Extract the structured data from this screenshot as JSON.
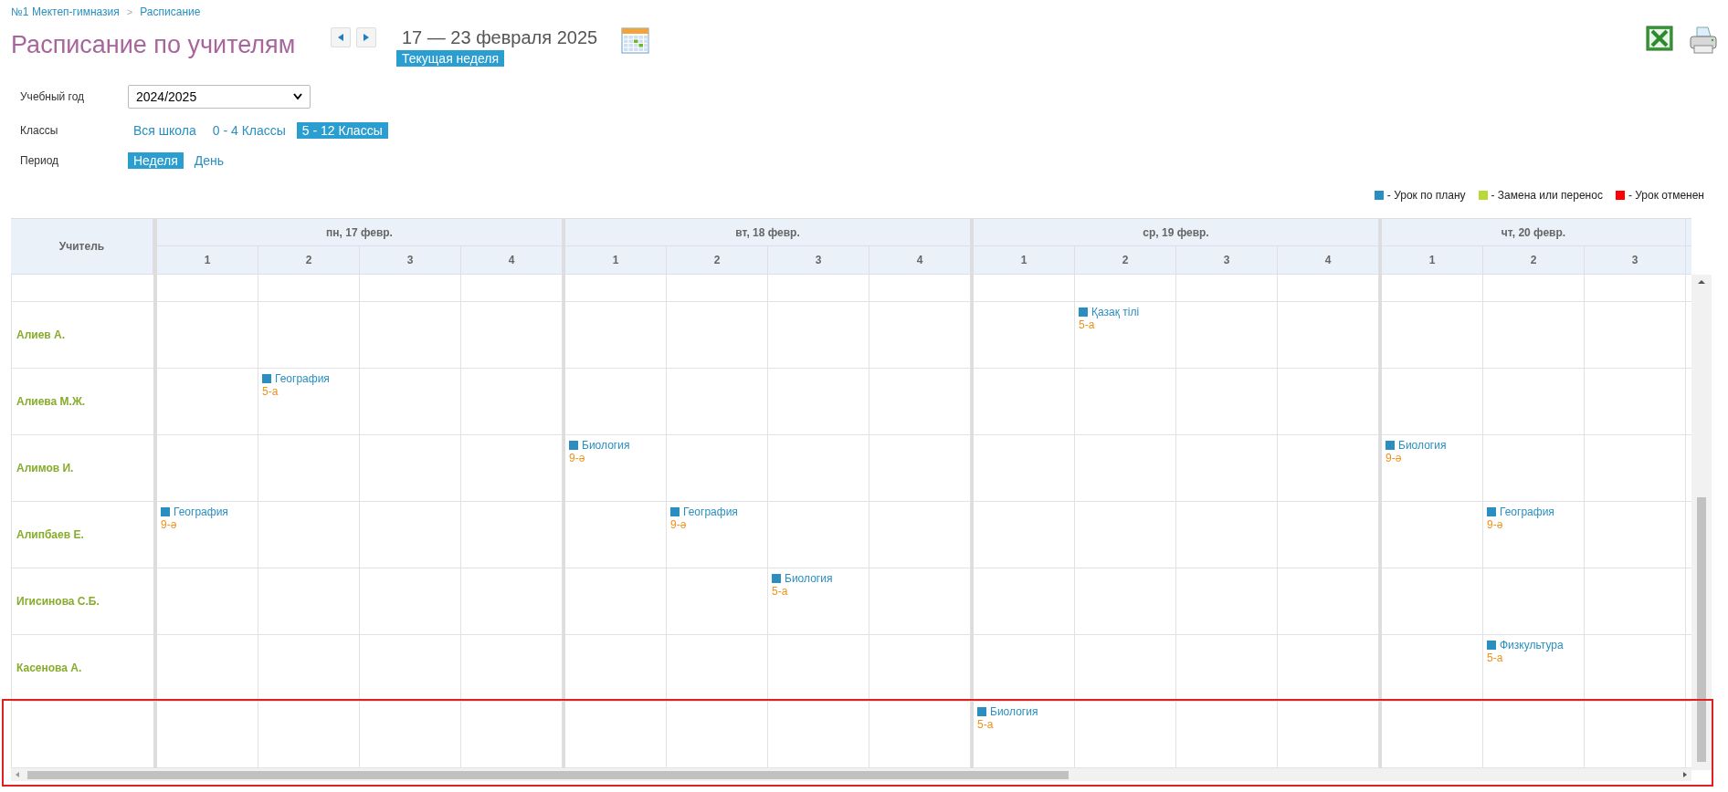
{
  "breadcrumb": {
    "items": [
      "№1 Мектеп-гимназия",
      "Расписание"
    ],
    "separator": ">"
  },
  "title": "Расписание по учителям",
  "week": {
    "range": "17 — 23 февраля 2025",
    "current_label": "Текущая неделя"
  },
  "filters": {
    "year_label": "Учебный год",
    "year_value": "2024/2025",
    "classes_label": "Классы",
    "classes": [
      {
        "label": "Вся школа",
        "selected": false
      },
      {
        "label": "0 - 4 Классы",
        "selected": false
      },
      {
        "label": "5 - 12 Классы",
        "selected": true
      }
    ],
    "period_label": "Период",
    "periods": [
      {
        "label": "Неделя",
        "selected": true
      },
      {
        "label": "День",
        "selected": false
      }
    ]
  },
  "legend": [
    {
      "label": "- Урок по плану",
      "color": "#2a8fc0"
    },
    {
      "label": "- Замена или перенос",
      "color": "#b8d936"
    },
    {
      "label": "- Урок отменен",
      "color": "#ff0000"
    }
  ],
  "table": {
    "teacher_header": "Учитель",
    "days": [
      {
        "label": "пн, 17 февр.",
        "periods": [
          "1",
          "2",
          "3",
          "4"
        ]
      },
      {
        "label": "вт, 18 февр.",
        "periods": [
          "1",
          "2",
          "3",
          "4"
        ]
      },
      {
        "label": "ср, 19 февр.",
        "periods": [
          "1",
          "2",
          "3",
          "4"
        ]
      },
      {
        "label": "чт, 20 февр.",
        "periods": [
          "1",
          "2",
          "3"
        ]
      }
    ],
    "rows": [
      {
        "teacher": null,
        "cells": [
          null,
          null,
          null,
          null,
          null,
          null,
          null,
          null,
          null,
          null,
          null,
          null,
          null,
          null,
          null
        ]
      },
      {
        "teacher": "Алиев А.",
        "cells": [
          null,
          null,
          null,
          null,
          null,
          null,
          null,
          null,
          null,
          {
            "subject": "Қазақ тілі",
            "class": "5-а",
            "color": "#2a8fc0"
          },
          null,
          null,
          null,
          null,
          null
        ]
      },
      {
        "teacher": "Алиева М.Ж.",
        "cells": [
          null,
          {
            "subject": "География",
            "class": "5-а",
            "color": "#2a8fc0"
          },
          null,
          null,
          null,
          null,
          null,
          null,
          null,
          null,
          null,
          null,
          null,
          null,
          null
        ]
      },
      {
        "teacher": "Алимов И.",
        "cells": [
          null,
          null,
          null,
          null,
          {
            "subject": "Биология",
            "class": "9-ә",
            "color": "#2a8fc0"
          },
          null,
          null,
          null,
          null,
          null,
          null,
          null,
          {
            "subject": "Биология",
            "class": "9-ә",
            "color": "#2a8fc0"
          },
          null,
          null
        ]
      },
      {
        "teacher": "Алипбаев Е.",
        "cells": [
          {
            "subject": "География",
            "class": "9-ә",
            "color": "#2a8fc0"
          },
          null,
          null,
          null,
          null,
          {
            "subject": "География",
            "class": "9-ә",
            "color": "#2a8fc0"
          },
          null,
          null,
          null,
          null,
          null,
          null,
          null,
          {
            "subject": "География",
            "class": "9-ә",
            "color": "#2a8fc0"
          },
          null
        ]
      },
      {
        "teacher": "Игисинова С.Б.",
        "cells": [
          null,
          null,
          null,
          null,
          null,
          null,
          {
            "subject": "Биология",
            "class": "5-а",
            "color": "#2a8fc0"
          },
          null,
          null,
          null,
          null,
          null,
          null,
          null,
          null
        ]
      },
      {
        "teacher": "Касенова А.",
        "cells": [
          null,
          null,
          null,
          null,
          null,
          null,
          null,
          null,
          null,
          null,
          null,
          null,
          null,
          {
            "subject": "Физкультура",
            "class": "5-а",
            "color": "#2a8fc0"
          },
          null
        ]
      },
      {
        "teacher": null,
        "highlighted": true,
        "cells": [
          null,
          null,
          null,
          null,
          null,
          null,
          null,
          null,
          {
            "subject": "Биология",
            "class": "5-а",
            "color": "#2a8fc0"
          },
          null,
          null,
          null,
          null,
          null,
          null
        ]
      }
    ]
  }
}
